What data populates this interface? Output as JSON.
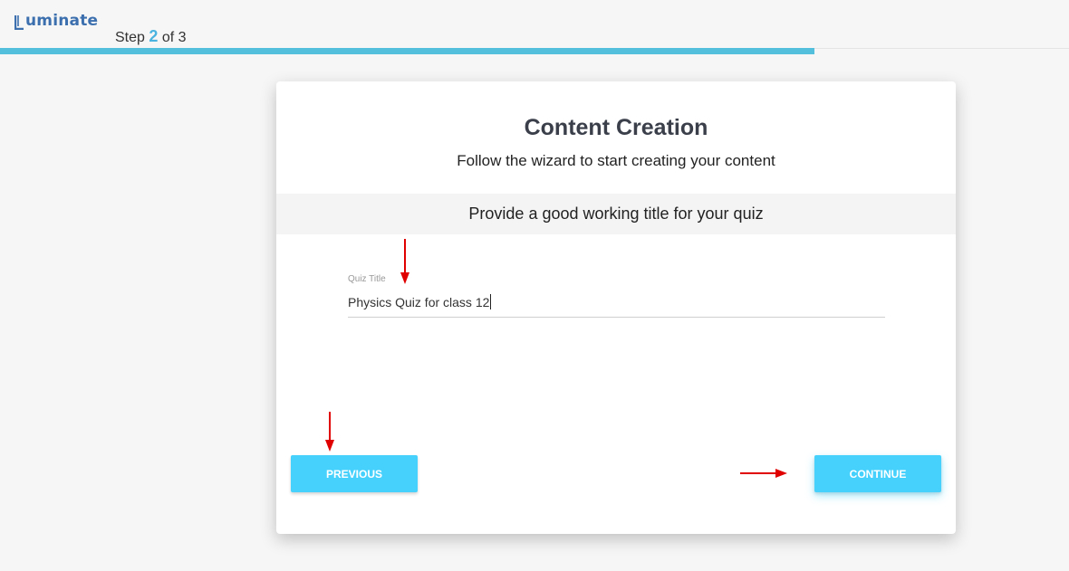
{
  "header": {
    "logo_text": "uminate",
    "step_prefix": "Step",
    "step_current": "2",
    "step_suffix": "of 3",
    "progress_fraction": 0.762,
    "accent_color": "#54bfdc"
  },
  "card": {
    "title": "Content Creation",
    "subtitle": "Follow the wizard to start creating your content",
    "prompt": "Provide a good working title for your quiz",
    "field": {
      "label": "Quiz Title",
      "value": "Physics Quiz for class 12"
    },
    "buttons": {
      "previous": "PREVIOUS",
      "continue": "CONTINUE",
      "color": "#45d1fb"
    }
  },
  "annotations": {
    "arrow_color": "#e00000",
    "arrow_icon": "red-arrow-icon"
  }
}
